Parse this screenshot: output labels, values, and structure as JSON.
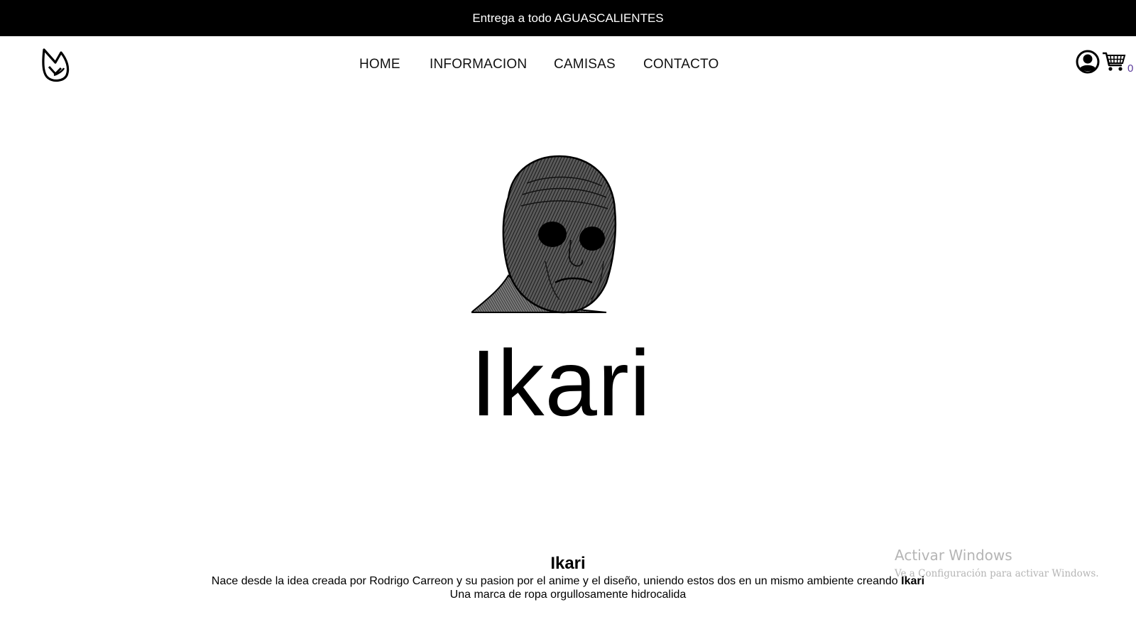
{
  "announcement": {
    "text": "Entrega a todo AGUASCALIENTES"
  },
  "header": {
    "logo_icon": "flame-logo-icon",
    "nav": [
      {
        "label": "HOME"
      },
      {
        "label": "INFORMACION"
      },
      {
        "label": "CAMISAS"
      },
      {
        "label": "CONTACTO"
      }
    ],
    "account_icon": "user-icon",
    "cart_icon": "shopping-cart-icon",
    "cart_count": "0"
  },
  "hero": {
    "image_icon": "sad-face-illustration",
    "title": "Ikari"
  },
  "about": {
    "title": "Ikari",
    "line1_text": "Nace desde la idea creada por Rodrigo Carreon y su pasion por el anime y el diseño, uniendo estos dos en un mismo ambiente creando",
    "line1_bold": "Ikari",
    "line2_text": "Una marca de ropa orgullosamente hidrocalida"
  },
  "watermark": {
    "title": "Activar Windows",
    "subtitle": "Ve a Configuración para activar Windows."
  }
}
